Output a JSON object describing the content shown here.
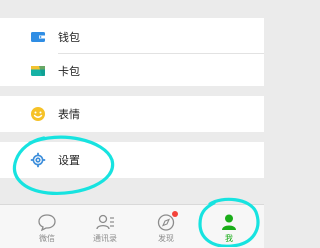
{
  "menu": {
    "wallet_label": "钱包",
    "cards_label": "卡包",
    "emoji_label": "表情",
    "settings_label": "设置"
  },
  "tabs": [
    {
      "label": "微信",
      "icon": "chat-bubble-icon",
      "active": false
    },
    {
      "label": "通讯录",
      "icon": "contacts-icon",
      "active": false
    },
    {
      "label": "发现",
      "icon": "compass-icon",
      "active": false,
      "badge_dot": true
    },
    {
      "label": "我",
      "icon": "person-icon",
      "active": true
    }
  ],
  "colors": {
    "accent_green": "#1aad19",
    "wallet_blue": "#2f8de4",
    "card_teal": "#16b2a5",
    "emoji_yellow": "#f6c227",
    "settings_blue": "#3d8edb",
    "annotation_cyan": "#17e3e0",
    "badge_red": "#f4433b"
  }
}
